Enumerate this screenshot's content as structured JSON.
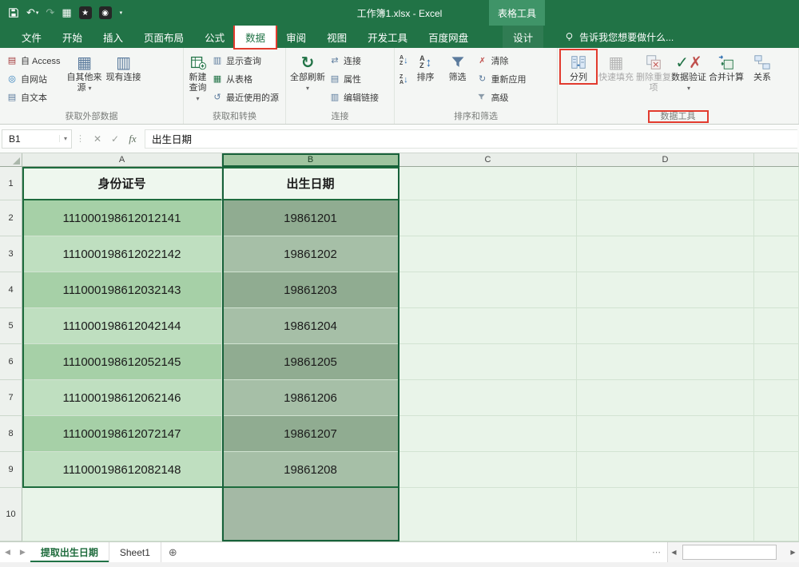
{
  "colors": {
    "excel_green": "#217346",
    "annotation_red": "#e23b2e",
    "selected_column_header": "#9fc49f",
    "band_dark": "#a6d0a7",
    "band_light": "#bfdfc0",
    "band_dark_selected": "#90ac91",
    "band_light_selected": "#a6bfa7",
    "sheet_background": "#e9f4e9"
  },
  "title_bar": {
    "title": "工作簿1.xlsx - Excel",
    "contextual_tools": "表格工具"
  },
  "ribbon_tabs": {
    "file": "文件",
    "home": "开始",
    "insert": "插入",
    "page_layout": "页面布局",
    "formulas": "公式",
    "data": "数据",
    "review": "审阅",
    "view": "视图",
    "developer": "开发工具",
    "baidu": "百度网盘",
    "design": "设计",
    "tell_me": "告诉我您想要做什么..."
  },
  "ribbon": {
    "get_external": {
      "label": "获取外部数据",
      "from_access": "自 Access",
      "from_web": "自网站",
      "from_text": "自文本",
      "from_other_sources": "自其他来源",
      "existing_connections": "现有连接"
    },
    "get_transform": {
      "label": "获取和转换",
      "new_query": "新建查询",
      "show_queries": "显示查询",
      "from_table": "从表格",
      "recent_sources": "最近使用的源"
    },
    "connections": {
      "label": "连接",
      "refresh_all": "全部刷新",
      "connections": "连接",
      "properties": "属性",
      "edit_links": "编辑链接"
    },
    "sort_filter": {
      "label": "排序和筛选",
      "sort": "排序",
      "filter": "筛选",
      "clear": "清除",
      "reapply": "重新应用",
      "advanced": "高级"
    },
    "data_tools": {
      "label": "数据工具",
      "text_to_columns": "分列",
      "flash_fill": "快速填充",
      "remove_duplicates": "删除重复项",
      "data_validation": "数据验证",
      "consolidate": "合并计算",
      "relationships": "关系"
    }
  },
  "formula_bar": {
    "name_box": "B1",
    "fx": "fx",
    "content": "出生日期"
  },
  "grid": {
    "column_headers": [
      "A",
      "B",
      "C",
      "D"
    ],
    "selected_column": "B",
    "active_cell": "B1",
    "row_numbers": [
      "1",
      "2",
      "3",
      "4",
      "5",
      "6",
      "7",
      "8",
      "9",
      "10"
    ]
  },
  "table": {
    "header_id": "身份证号",
    "header_birth": "出生日期",
    "rows": [
      {
        "id": "111000198612012141",
        "birth": "19861201"
      },
      {
        "id": "111000198612022142",
        "birth": "19861202"
      },
      {
        "id": "111000198612032143",
        "birth": "19861203"
      },
      {
        "id": "111000198612042144",
        "birth": "19861204"
      },
      {
        "id": "111000198612052145",
        "birth": "19861205"
      },
      {
        "id": "111000198612062146",
        "birth": "19861206"
      },
      {
        "id": "111000198612072147",
        "birth": "19861207"
      },
      {
        "id": "111000198612082148",
        "birth": "19861208"
      }
    ]
  },
  "sheet_bar": {
    "tab_active": "提取出生日期",
    "tab_inactive": "Sheet1"
  }
}
